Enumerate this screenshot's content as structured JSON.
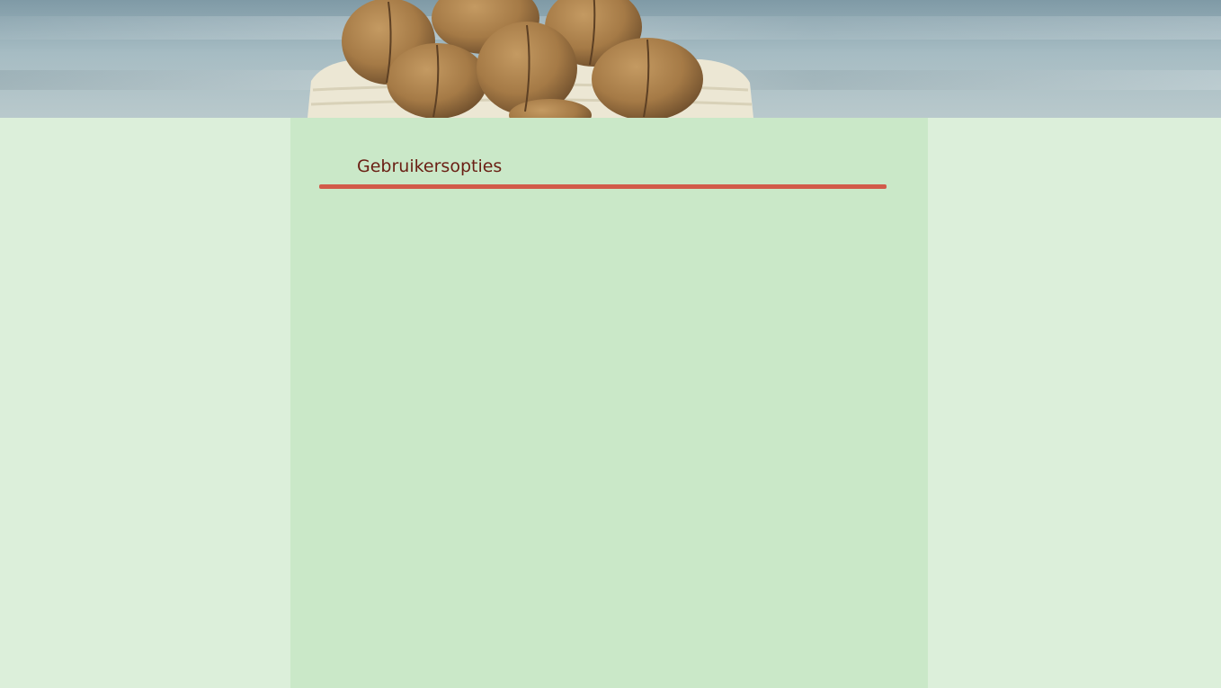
{
  "hero": {
    "image": "walnuts-in-bag",
    "colors": {
      "background": "#a6bcc3",
      "walnut": "#a57a46",
      "bag": "#ece7d4"
    }
  },
  "main": {
    "section_title": "Gebruikersopties",
    "colors": {
      "title": "#6a1f14",
      "rule": "#d25a4a",
      "content_bg": "#cae8c8",
      "page_bg": "#dcefda"
    }
  }
}
